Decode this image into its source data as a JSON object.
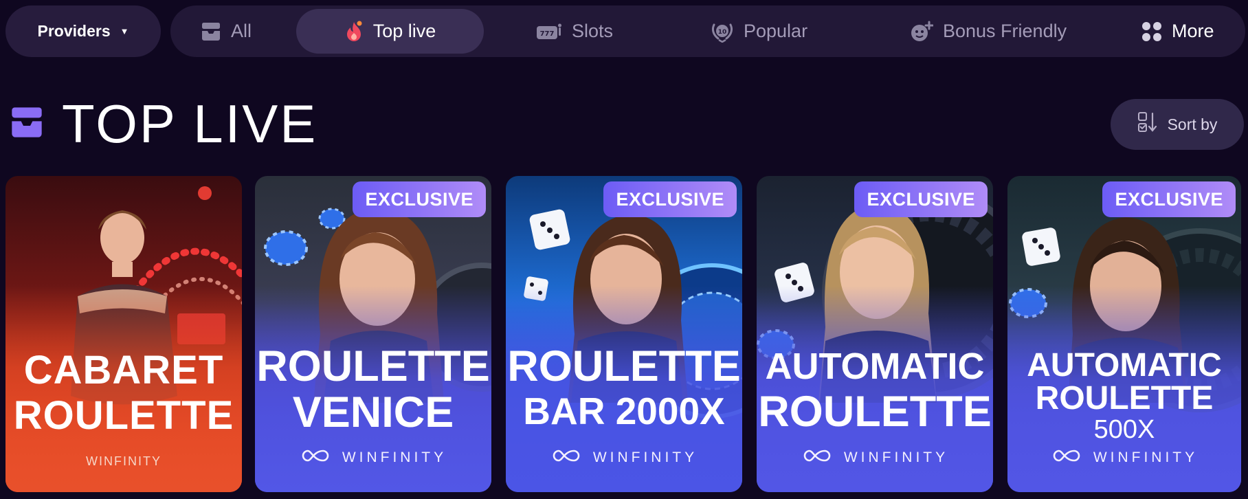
{
  "providers_label": "Providers",
  "tabs": [
    {
      "label": "All",
      "icon": "inbox-icon",
      "active": false
    },
    {
      "label": "Top live",
      "icon": "flame-icon",
      "active": true
    },
    {
      "label": "Slots",
      "icon": "slot-machine-icon",
      "active": false
    },
    {
      "label": "Popular",
      "icon": "laurel-badge-icon",
      "active": false
    },
    {
      "label": "Bonus Friendly",
      "icon": "bonus-face-icon",
      "active": false
    },
    {
      "label": "More",
      "icon": "grid-dots-icon",
      "active": false
    }
  ],
  "section": {
    "title": "TOP LIVE",
    "icon": "inbox-icon",
    "sort_label": "Sort by"
  },
  "games": [
    {
      "title_line1": "CABARET",
      "title_line2": "ROULETTE",
      "title_line3": "",
      "provider": "WINFINITY",
      "badge": ""
    },
    {
      "title_line1": "ROULETTE",
      "title_line2": "VENICE",
      "title_line3": "",
      "provider": "WINFINITY",
      "badge": "EXCLUSIVE"
    },
    {
      "title_line1": "ROULETTE",
      "title_line2": "BAR 2000X",
      "title_line3": "",
      "provider": "WINFINITY",
      "badge": "EXCLUSIVE"
    },
    {
      "title_line1": "AUTOMATIC",
      "title_line2": "ROULETTE",
      "title_line3": "",
      "provider": "WINFINITY",
      "badge": "EXCLUSIVE"
    },
    {
      "title_line1": "AUTOMATIC",
      "title_line2": "ROULETTE",
      "title_line3": "500X",
      "provider": "WINFINITY",
      "badge": "EXCLUSIVE"
    }
  ],
  "colors": {
    "background": "#0f0720",
    "badge_start": "#6c5cf5",
    "badge_end": "#b08cf7",
    "accent_purple": "#8a6cf5"
  }
}
